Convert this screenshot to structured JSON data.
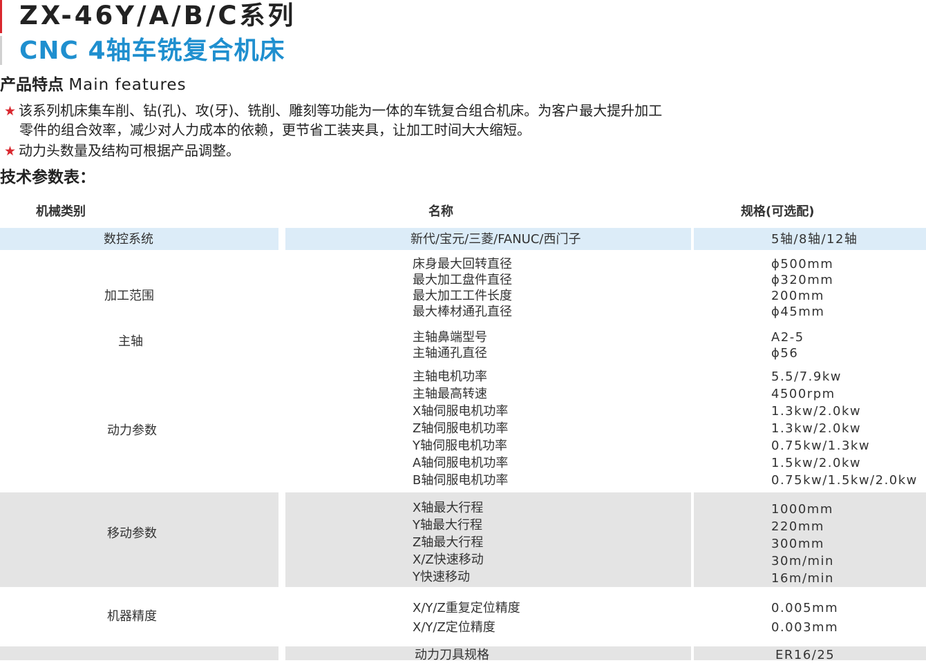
{
  "header": {
    "model": "ZX-46Y/A/B/C系列",
    "subtitle": "CNC 4轴车铣复合机床"
  },
  "features": {
    "heading_cn": "产品特点",
    "heading_en": "Main features",
    "bullet1_line1": "该系列机床集车削、钻(孔)、攻(牙)、铣削、雕刻等功能为一体的车铣复合组合机床。为客户最大提升加工",
    "bullet1_line2": "零件的组合效率，减少对人力成本的依赖，更节省工装夹具，让加工时间大大缩短。",
    "bullet2": "动力头数量及结构可根据产品调整。",
    "star_color": "#d9272e"
  },
  "spec_table": {
    "title": "技术参数表：",
    "headers": [
      "机械类别",
      "名称",
      "规格(可选配)"
    ],
    "groups": [
      {
        "category": "数控系统",
        "names": [
          "新代/宝元/三菱/FANUC/西门子"
        ],
        "values": [
          "5轴/8轴/12轴"
        ]
      },
      {
        "category": "加工范围",
        "names": [
          "床身最大回转直径",
          "最大加工盘件直径",
          "最大加工工件长度",
          "最大棒材通孔直径"
        ],
        "values": [
          "ϕ500mm",
          "ϕ320mm",
          "200mm",
          "ϕ45mm"
        ]
      },
      {
        "category": "主轴",
        "names": [
          "主轴鼻端型号",
          "主轴通孔直径"
        ],
        "values": [
          "A2-5",
          "ϕ56"
        ]
      },
      {
        "category": "动力参数",
        "names": [
          "主轴电机功率",
          "主轴最高转速",
          "X轴伺服电机功率",
          "Z轴伺服电机功率",
          "Y轴伺服电机功率",
          "A轴伺服电机功率",
          "B轴伺服电机功率"
        ],
        "values": [
          "5.5/7.9kw",
          "4500rpm",
          "1.3kw/2.0kw",
          "1.3kw/2.0kw",
          "0.75kw/1.3kw",
          "1.5kw/2.0kw",
          "0.75kw/1.5kw/2.0kw"
        ]
      },
      {
        "category": "移动参数",
        "names": [
          "X轴最大行程",
          "Y轴最大行程",
          "Z轴最大行程",
          "X/Z快速移动",
          "Y快速移动"
        ],
        "values": [
          "1000mm",
          "220mm",
          "300mm",
          "30m/min",
          "16m/min"
        ]
      },
      {
        "category": "机器精度",
        "names": [
          "X/Y/Z重复定位精度",
          "X/Y/Z定位精度"
        ],
        "values": [
          "0.005mm",
          "0.003mm"
        ]
      },
      {
        "category": "",
        "names": [
          "动力刀具规格"
        ],
        "values": [
          "ER16/25"
        ]
      }
    ]
  },
  "colors": {
    "accent_blue": "#1f8fcf",
    "band_blue": "#dcecf8",
    "band_gray": "#e4e4e4",
    "red": "#d9272e"
  }
}
